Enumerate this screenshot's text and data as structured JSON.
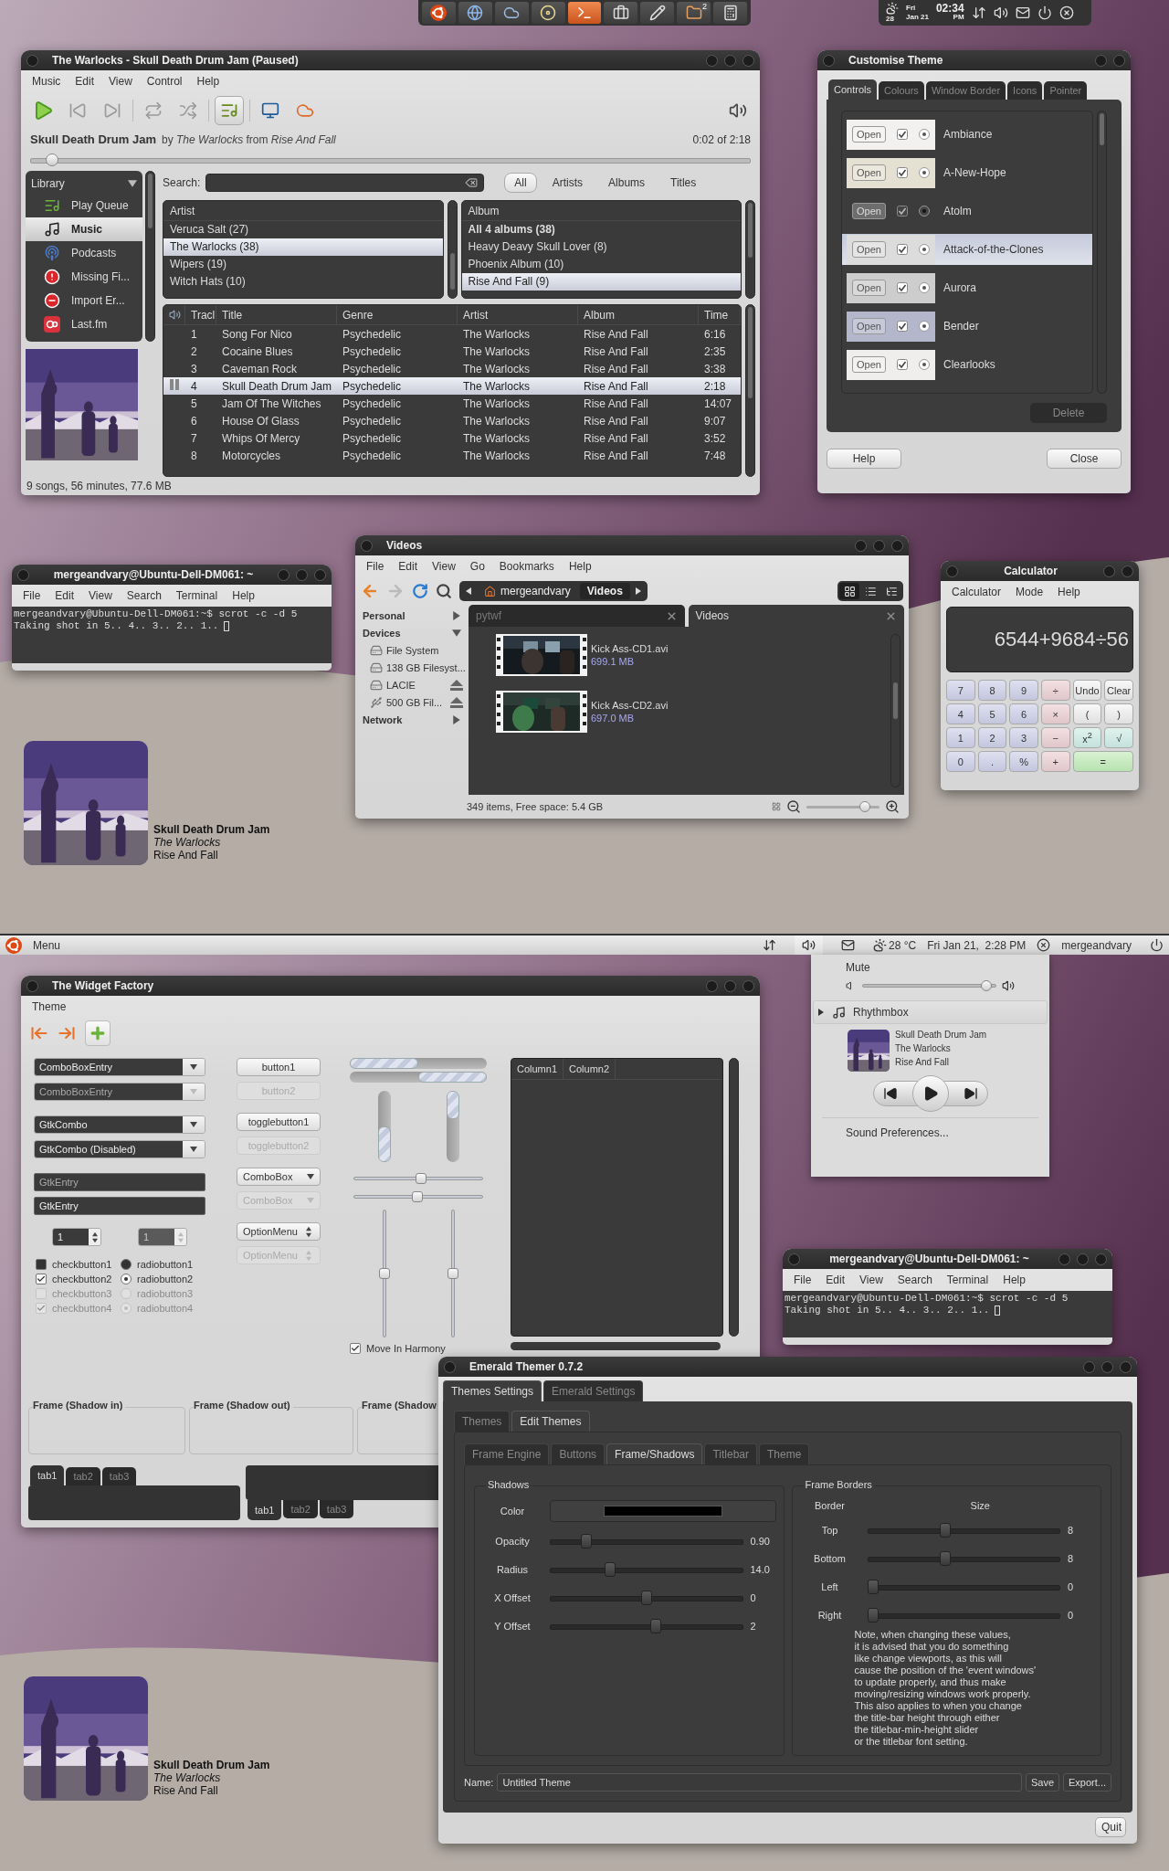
{
  "top_desktop": {
    "dock": {
      "items": [
        {
          "selected": false
        },
        {
          "selected": false
        },
        {
          "selected": false
        },
        {
          "selected": false
        },
        {
          "selected": true
        },
        {
          "selected": false
        },
        {
          "selected": false
        },
        {
          "selected": false,
          "badge": "2"
        },
        {
          "selected": false
        }
      ]
    },
    "tray": {
      "weather_temp": "28",
      "day": "Fri",
      "date": "Jan 21",
      "time": "02:34",
      "period": "PM"
    },
    "music_player": {
      "title": "The Warlocks - Skull Death Drum Jam (Paused)",
      "menu": [
        "Music",
        "Edit",
        "View",
        "Control",
        "Help"
      ],
      "now_playing": {
        "title": "Skull Death Drum Jam",
        "info": "by *The Warlocks* from *Rise And Fall*",
        "time": "0:02 of 2:18",
        "level": 0.03
      },
      "library": {
        "heading": "Library",
        "items": [
          {
            "label": "Play Queue",
            "selected": false
          },
          {
            "label": "Music",
            "selected": true
          },
          {
            "label": "Podcasts",
            "selected": false
          },
          {
            "label": "Missing Fi...",
            "selected": false
          },
          {
            "label": "Import Er...",
            "selected": false
          },
          {
            "label": "Last.fm",
            "selected": false
          }
        ]
      },
      "search": {
        "label": "Search:"
      },
      "filters": [
        {
          "label": "All",
          "selected": true
        },
        {
          "label": "Artists",
          "selected": false
        },
        {
          "label": "Albums",
          "selected": false
        },
        {
          "label": "Titles",
          "selected": false
        }
      ],
      "artists": {
        "heading": "Artist",
        "rows": [
          {
            "label": "Veruca Salt (27)",
            "selected": false,
            "bold": false
          },
          {
            "label": "The Warlocks (38)",
            "selected": true,
            "bold": false
          },
          {
            "label": "Wipers (19)",
            "selected": false,
            "bold": false
          },
          {
            "label": "Witch Hats (10)",
            "selected": false,
            "bold": false
          }
        ]
      },
      "albums": {
        "heading": "Album",
        "rows": [
          {
            "label": "All 4 albums (38)",
            "selected": false,
            "bold": true
          },
          {
            "label": "Heavy Deavy Skull Lover (8)",
            "selected": false,
            "bold": false
          },
          {
            "label": "Phoenix Album (10)",
            "selected": false,
            "bold": false
          },
          {
            "label": "Rise And Fall (9)",
            "selected": true,
            "bold": false
          }
        ]
      },
      "tracks": {
        "columns": [
          "Tracl",
          "Title",
          "Genre",
          "Artist",
          "Album",
          "Time"
        ],
        "rows": [
          {
            "cells": [
              "1",
              "Song For Nico",
              "Psychedelic",
              "The Warlocks",
              "Rise And Fall",
              "6:16"
            ],
            "selected": false,
            "playing": false
          },
          {
            "cells": [
              "2",
              "Cocaine Blues",
              "Psychedelic",
              "The Warlocks",
              "Rise And Fall",
              "2:35"
            ],
            "selected": false,
            "playing": false
          },
          {
            "cells": [
              "3",
              "Caveman Rock",
              "Psychedelic",
              "The Warlocks",
              "Rise And Fall",
              "3:38"
            ],
            "selected": false,
            "playing": false
          },
          {
            "cells": [
              "4",
              "Skull Death Drum Jam",
              "Psychedelic",
              "The Warlocks",
              "Rise And Fall",
              "2:18"
            ],
            "selected": true,
            "playing": true
          },
          {
            "cells": [
              "5",
              "Jam Of The Witches",
              "Psychedelic",
              "The Warlocks",
              "Rise And Fall",
              "14:07"
            ],
            "selected": false,
            "playing": false
          },
          {
            "cells": [
              "6",
              "House Of Glass",
              "Psychedelic",
              "The Warlocks",
              "Rise And Fall",
              "9:07"
            ],
            "selected": false,
            "playing": false
          },
          {
            "cells": [
              "7",
              "Whips Of Mercy",
              "Psychedelic",
              "The Warlocks",
              "Rise And Fall",
              "3:52"
            ],
            "selected": false,
            "playing": false
          },
          {
            "cells": [
              "8",
              "Motorcycles",
              "Psychedelic",
              "The Warlocks",
              "Rise And Fall",
              "7:48"
            ],
            "selected": false,
            "playing": false
          }
        ]
      },
      "status": "9 songs, 56 minutes, 77.6 MB"
    },
    "theme_dialog": {
      "title": "Customise Theme",
      "tabs": [
        {
          "label": "Controls",
          "selected": true
        },
        {
          "label": "Colours",
          "selected": false
        },
        {
          "label": "Window Border",
          "selected": false
        },
        {
          "label": "Icons",
          "selected": false
        },
        {
          "label": "Pointer",
          "selected": false
        }
      ],
      "themes": [
        {
          "name": "Ambiance",
          "button": "Open",
          "color": "#f2f1ef",
          "selected": false
        },
        {
          "name": "A-New-Hope",
          "button": "Open",
          "color": "#e4e1d3",
          "selected": false
        },
        {
          "name": "Atolm",
          "button": "Open",
          "color": "#3c3c3c",
          "selected": false
        },
        {
          "name": "Attack-of-the-Clones",
          "button": "Open",
          "color": "#dcdcdc",
          "selected": true
        },
        {
          "name": "Aurora",
          "button": "Open",
          "color": "#cdcdcd",
          "selected": false
        },
        {
          "name": "Bender",
          "button": "Open",
          "color": "#b4b7cb",
          "selected": false
        },
        {
          "name": "Clearlooks",
          "button": "Open",
          "color": "#efeeec",
          "selected": false
        }
      ],
      "delete": "Delete",
      "help": "Help",
      "close": "Close"
    },
    "terminal": {
      "title": "mergeandvary@Ubuntu-Dell-DM061: ~",
      "menu": [
        "File",
        "Edit",
        "View",
        "Search",
        "Terminal",
        "Help"
      ],
      "lines": [
        "mergeandvary@Ubuntu-Dell-DM061:~$ scrot -c -d 5",
        "Taking shot in 5.. 4.. 3.. 2.. 1.."
      ]
    },
    "file_manager": {
      "title": "Videos",
      "menu": [
        "File",
        "Edit",
        "View",
        "Go",
        "Bookmarks",
        "Help"
      ],
      "path": [
        {
          "label": "mergeandvary",
          "selected": false
        },
        {
          "label": "Videos",
          "selected": true
        }
      ],
      "view_modes": [
        {
          "selected": true
        },
        {
          "selected": false
        },
        {
          "selected": false
        }
      ],
      "sidebar": [
        {
          "label": "Personal",
          "expanded": false
        },
        {
          "label": "Devices",
          "expanded": true,
          "children": [
            {
              "label": "File System",
              "kind": "drive",
              "ejectable": false
            },
            {
              "label": "138 GB Filesyst...",
              "kind": "drive",
              "ejectable": false
            },
            {
              "label": "LACIE",
              "kind": "drive",
              "ejectable": true
            },
            {
              "label": "500 GB Fil...",
              "kind": "usb",
              "ejectable": true
            }
          ]
        },
        {
          "label": "Network",
          "expanded": false
        }
      ],
      "tabs": [
        {
          "label": "pytwf",
          "selected": false
        },
        {
          "label": "Videos",
          "selected": true
        }
      ],
      "files": [
        {
          "name": "Kick Ass-CD1.avi",
          "size": "699.1 MB",
          "kind": "picture"
        },
        {
          "name": "Kick Ass-CD2.avi",
          "size": "697.0 MB",
          "kind": "picture"
        }
      ],
      "status": "349 items, Free space: 5.4 GB",
      "zoom": {
        "level": 0.8
      }
    },
    "calculator": {
      "title": "Calculator",
      "menu": [
        "Calculator",
        "Mode",
        "Help"
      ],
      "display": "6544+9684÷56",
      "keys": [
        {
          "label": "7",
          "kind": "digit"
        },
        {
          "label": "8",
          "kind": "digit"
        },
        {
          "label": "9",
          "kind": "digit"
        },
        {
          "label": "÷",
          "kind": "op"
        },
        {
          "label": "Undo",
          "kind": "fn"
        },
        {
          "label": "Clear",
          "kind": "fn"
        },
        {
          "label": "4",
          "kind": "digit"
        },
        {
          "label": "5",
          "kind": "digit"
        },
        {
          "label": "6",
          "kind": "digit"
        },
        {
          "label": "×",
          "kind": "op"
        },
        {
          "label": "(",
          "kind": "fn"
        },
        {
          "label": ")",
          "kind": "fn"
        },
        {
          "label": "1",
          "kind": "digit"
        },
        {
          "label": "2",
          "kind": "digit"
        },
        {
          "label": "3",
          "kind": "digit"
        },
        {
          "label": "−",
          "kind": "op"
        },
        {
          "label": "x$^{2}$",
          "kind": "sci"
        },
        {
          "label": "√",
          "kind": "sci"
        },
        {
          "label": "0",
          "kind": "digit"
        },
        {
          "label": ".",
          "kind": "digit"
        },
        {
          "label": "%",
          "kind": "digit"
        },
        {
          "label": "+",
          "kind": "op"
        },
        {
          "label": "=",
          "kind": "equals"
        }
      ]
    },
    "desktop_widget": {
      "title": "Skull Death Drum Jam",
      "artist": "The Warlocks",
      "album": "Rise And Fall"
    }
  },
  "bottom_desktop": {
    "panel": {
      "menu": "Menu",
      "indicators": [
        {
          "selected": false
        },
        {
          "selected": true
        },
        {
          "selected": false
        }
      ],
      "weather": "28 °C",
      "clock": "Fri Jan 21,  2:28 PM",
      "user": "mergeandvary"
    },
    "sound_menu": {
      "mute": "Mute",
      "volume": {
        "level": 0.93
      },
      "player": "Rhythmbox",
      "track": {
        "title": "Skull Death Drum Jam",
        "artist": "The Warlocks",
        "album": "Rise And Fall"
      },
      "preferences": "Sound Preferences..."
    },
    "widget_factory": {
      "title": "The Widget Factory",
      "menu": [
        "Theme"
      ],
      "combos": [
        {
          "label": "ComboBoxEntry",
          "disabled": false
        },
        {
          "label": "ComboBoxEntry",
          "disabled": true
        },
        {
          "label": "GtkCombo",
          "disabled": false
        },
        {
          "label": "GtkCombo (Disabled)",
          "disabled": false
        }
      ],
      "entries": [
        {
          "value": "GtkEntry",
          "disabled": true
        },
        {
          "value": "GtkEntry",
          "disabled": false
        }
      ],
      "spins": [
        {
          "value": "1",
          "disabled": false
        },
        {
          "value": "1",
          "disabled": true
        }
      ],
      "checks": [
        {
          "label": "checkbutton1",
          "checked": false,
          "disabled": false
        },
        {
          "label": "checkbutton2",
          "checked": true,
          "disabled": false
        },
        {
          "label": "checkbutton3",
          "checked": false,
          "disabled": true
        },
        {
          "label": "checkbutton4",
          "checked": true,
          "disabled": true
        }
      ],
      "radios": [
        {
          "label": "radiobutton1",
          "selected": false,
          "disabled": false
        },
        {
          "label": "radiobutton2",
          "selected": true,
          "disabled": false
        },
        {
          "label": "radiobutton3",
          "selected": false,
          "disabled": true
        },
        {
          "label": "radiobutton4",
          "selected": true,
          "disabled": true
        }
      ],
      "buttons": [
        {
          "label": "button1",
          "kind": "button",
          "disabled": false
        },
        {
          "label": "button2",
          "kind": "button",
          "disabled": true
        },
        {
          "label": "togglebutton1",
          "kind": "button",
          "disabled": false
        },
        {
          "label": "togglebutton2",
          "kind": "button",
          "disabled": true
        },
        {
          "label": "ComboBox",
          "kind": "combo",
          "disabled": false
        },
        {
          "label": "ComboBox",
          "kind": "combo",
          "disabled": true
        },
        {
          "label": "OptionMenu",
          "kind": "option",
          "disabled": false
        },
        {
          "label": "OptionMenu",
          "kind": "option",
          "disabled": true
        }
      ],
      "hprogress": [
        {
          "level": 0.5,
          "inverted": false
        },
        {
          "level": 0.5,
          "inverted": true
        }
      ],
      "vprogress": [
        {
          "level": 0.5,
          "inverted": false
        },
        {
          "level": 0.4,
          "inverted": true
        }
      ],
      "hscales": [
        {
          "level": 0.52
        },
        {
          "level": 0.49
        }
      ],
      "vscales": [
        {
          "level": 0.5
        },
        {
          "level": 0.5
        }
      ],
      "harmony": {
        "label": "Move In Harmony",
        "checked": true
      },
      "tree": {
        "columns": [
          "Column1",
          "Column2"
        ]
      },
      "frames": [
        "Frame (Shadow in)",
        "Frame (Shadow out)",
        "Frame (Shadow"
      ],
      "notebooks": [
        {
          "tabs_below": false,
          "tabs": [
            {
              "label": "tab1",
              "selected": true
            },
            {
              "label": "tab2",
              "selected": false
            },
            {
              "label": "tab3",
              "selected": false
            }
          ]
        },
        {
          "tabs_below": true,
          "tabs": [
            {
              "label": "tab1",
              "selected": true
            },
            {
              "label": "tab2",
              "selected": false
            },
            {
              "label": "tab3",
              "selected": false
            }
          ]
        }
      ]
    },
    "terminal": {
      "title": "mergeandvary@Ubuntu-Dell-DM061: ~",
      "menu": [
        "File",
        "Edit",
        "View",
        "Search",
        "Terminal",
        "Help"
      ],
      "lines": [
        "mergeandvary@Ubuntu-Dell-DM061:~$ scrot -c -d 5",
        "Taking shot in 5.. 4.. 3.. 2.. 1.."
      ]
    },
    "theme_editor": {
      "title": "Emerald Themer 0.7.2",
      "tabs": [
        {
          "label": "Themes Settings",
          "selected": true
        },
        {
          "label": "Emerald Settings",
          "selected": false
        }
      ],
      "subtabs": [
        {
          "label": "Themes",
          "selected": false
        },
        {
          "label": "Edit Themes",
          "selected": true
        }
      ],
      "pages": [
        {
          "label": "Frame Engine",
          "selected": false
        },
        {
          "label": "Buttons",
          "selected": false
        },
        {
          "label": "Frame/Shadows",
          "selected": true
        },
        {
          "label": "Titlebar",
          "selected": false
        },
        {
          "label": "Theme",
          "selected": false
        }
      ],
      "shadows": {
        "heading": "Shadows",
        "color_label": "Color",
        "color": "#000000",
        "sliders": [
          {
            "label": "Opacity",
            "level": 0.17,
            "value": "0.90"
          },
          {
            "label": "Radius",
            "level": 0.3,
            "value": "14.0"
          },
          {
            "label": "X Offset",
            "level": 0.5,
            "value": "0"
          },
          {
            "label": "Y Offset",
            "level": 0.55,
            "value": "2"
          }
        ]
      },
      "borders": {
        "heading": "Frame Borders",
        "col1": "Border",
        "col2": "Size",
        "sliders": [
          {
            "label": "Top",
            "level": 0.4,
            "value": "8"
          },
          {
            "label": "Bottom",
            "level": 0.4,
            "value": "8"
          },
          {
            "label": "Left",
            "level": 0,
            "value": "0"
          },
          {
            "label": "Right",
            "level": 0,
            "value": "0"
          }
        ],
        "note": [
          "Note, when changing these values,",
          "it is advised that you do something",
          "like change viewports, as this will",
          "cause the position of the 'event windows'",
          "to update properly, and thus make",
          "moving/resizing windows work properly.",
          "This also applies to when you change",
          "the title-bar height through either",
          "the titlebar-min-height slider",
          "or the titlebar font setting."
        ]
      },
      "name_label": "Name:",
      "name_value": "Untitled Theme",
      "save": "Save",
      "export": "Export...",
      "quit": "Quit"
    },
    "desktop_widget": {
      "title": "Skull Death Drum Jam",
      "artist": "The Warlocks",
      "album": "Rise And Fall"
    }
  }
}
